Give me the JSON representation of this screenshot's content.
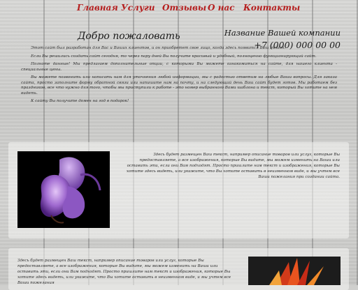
{
  "nav": {
    "items": [
      "Главная",
      "Услуги",
      "Отзывы",
      "О нас",
      "Контакты"
    ]
  },
  "header": {
    "welcome": "Добро пожаловать",
    "company_name": "Название Вашей компании",
    "phone": "+7 (000) 000 00 00"
  },
  "intro": {
    "paragraphs": [
      "Этот сайт был разработан для Вас и Ваших клиентов, и он приобретет свое лицо, когда здесь появится Ваш текст.",
      "Если Вы решились создать сайт сегодня, то через пару дней Вы получите красивый и удобный, полноценно функционирующий сайт.",
      "Полноте данные! Мы предлагаем дополнительные опции, с которыми Вы можете ознакомиться на сайте, для нашего клиента - специальные цены.",
      "Вы можете позвонить или написать нам для уточнения любой информации, мы с радостью ответим на любые Ваши вопросы. Для заказа сайта, просто заполните форму обратной связи или напишите нам на почту, и на следующий день Ваш сайт будет готов. Мы работаем без праздников, все что нужно для того, чтобы мы приступили к работе - это номер выбранного Вами шаблона и текст, который Вы хотите на нем видеть.",
      "К сайту Вы получите домен на год в подарок!"
    ]
  },
  "panel1": {
    "text": "Здесь будет размещен Ваш текст, например описание товаров или услуг, которые Вы предоставляете, а все изображения, которые Вы видите, мы можем изменить на Ваши или оставить эти, если они Вам подходят. Просто пришлите нам текст и изображения, которые Вы хотите здесь видеть, или укажите, что Вы хотите оставить в неизменном виде, и мы учтем все Ваши пожелания при создании сайта."
  },
  "panel2": {
    "text": "Здесь будет размещен Ваш текст, например описание товаров или услуг, которые Вы предоставляете, а все изображения, которые Вы видите, мы можем изменить на Ваши или оставить эти, если они Вам подходят. Просто пришлите нам текст и изображения, которые Вы хотите здесь видеть, или укажите, что Вы хотите оставить в неизменном виде, и мы учтем все Ваши пожелания"
  },
  "colors": {
    "nav_link": "#b51d1d",
    "text": "#2a2a2a"
  }
}
